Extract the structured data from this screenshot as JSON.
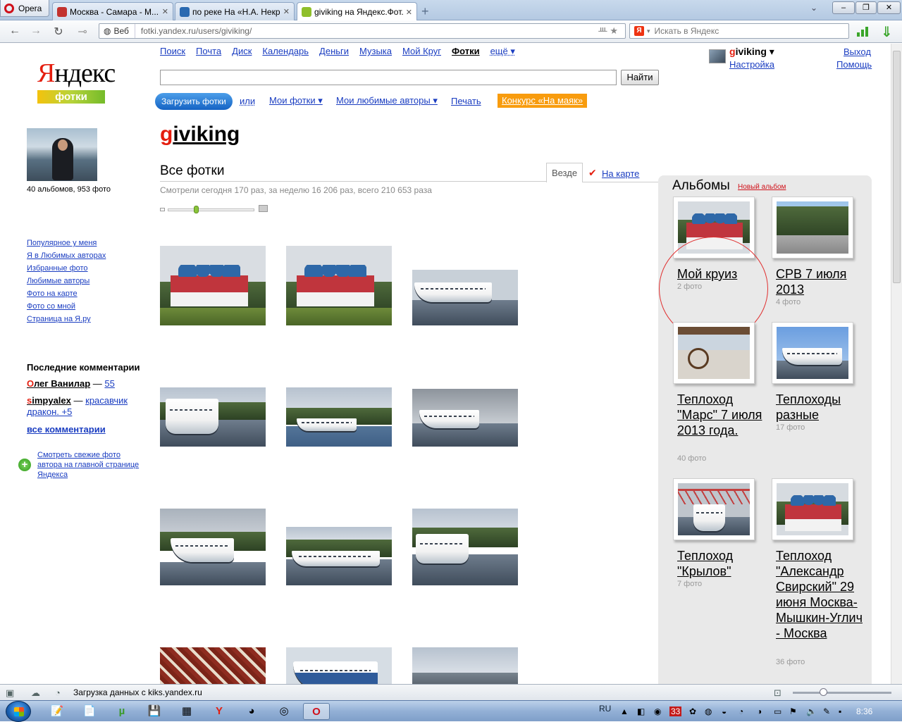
{
  "browser": {
    "menu_label": "Opera",
    "tabs": [
      {
        "label": "Москва - Самара - М...",
        "color": "#c2322e"
      },
      {
        "label": "по реке На «Н.А. Некр...",
        "color": "#2a69b0"
      },
      {
        "label": "giviking на Яндекс.Фот...",
        "color": "#8fbf2b"
      }
    ],
    "new_tab_icon": "plus-icon",
    "address": {
      "badge": "Веб",
      "url": "fotki.yandex.ru/users/giviking/"
    },
    "search": {
      "placeholder": "Искать в Яндекс"
    }
  },
  "page": {
    "logo": {
      "yandex_first": "Я",
      "yandex_rest": "ндекс",
      "fotki": "фотки"
    },
    "services": {
      "items": [
        "Поиск",
        "Почта",
        "Диск",
        "Календарь",
        "Деньги",
        "Музыка",
        "Мой Круг",
        "Фотки"
      ],
      "more": "ещё ▾"
    },
    "find_button": "Найти",
    "user": {
      "name_first": "g",
      "name_rest": "iviking ▾",
      "settings": "Настройка",
      "logout": "Выход",
      "help": "Помощь"
    },
    "actions": {
      "upload": "Загрузить фотки",
      "or": "или",
      "my_photos": "Мои фотки ▾",
      "fav_authors": "Мои любимые авторы ▾",
      "print": "Печать",
      "contest": "Конкурс «На маяк»"
    },
    "profile": {
      "stats": "40 альбомов, 953 фото",
      "links": [
        "Популярное у меня",
        "Я в Любимых авторах",
        "Избранные фото",
        "Любимые авторы",
        "Фото на карте",
        "Фото со мной",
        "Страница на Я.ру"
      ]
    },
    "comments": {
      "title": "Последние комментарии",
      "items": [
        {
          "author_first": "О",
          "author_rest": "лег Ванилар",
          "sep": " — ",
          "text": "55"
        },
        {
          "author_first": "s",
          "author_rest": "impyalex",
          "sep": " — ",
          "text": "красавчик дракон. +5"
        }
      ],
      "all": "все комментарии"
    },
    "fresh_link": "Смотреть свежие фото автора на главной странице Яндекса",
    "author": {
      "first": "g",
      "rest": "iviking"
    },
    "all_photos": "Все фотки",
    "tab_everywhere": "Везде",
    "tab_map": "На карте",
    "views_stats": "Смотрели сегодня 170 раз, за неделю 16 206 раз, всего 210 653 раза",
    "albums": {
      "title": "Альбомы",
      "new_album": "Новый альбом",
      "items": [
        {
          "name": "Мой круиз",
          "count": "2 фото"
        },
        {
          "name": "СРВ 7 июля 2013",
          "count": "4 фото"
        },
        {
          "name": "Теплоход \"Марс\" 7 июля 2013 года.",
          "count": "40 фото"
        },
        {
          "name": "Теплоходы разные",
          "count": "17 фото"
        },
        {
          "name": "Теплоход \"Крылов\"",
          "count": "7 фото"
        },
        {
          "name": "Теплоход \"Александр Свирский\" 29 июня Москва-Мышкин-Углич - Москва",
          "count": "36 фото"
        }
      ]
    }
  },
  "statusbar": {
    "text": "Загрузка данных с kiks.yandex.ru"
  },
  "taskbar": {
    "lang": "RU",
    "tray_badge": "33",
    "clock": "8:36"
  }
}
